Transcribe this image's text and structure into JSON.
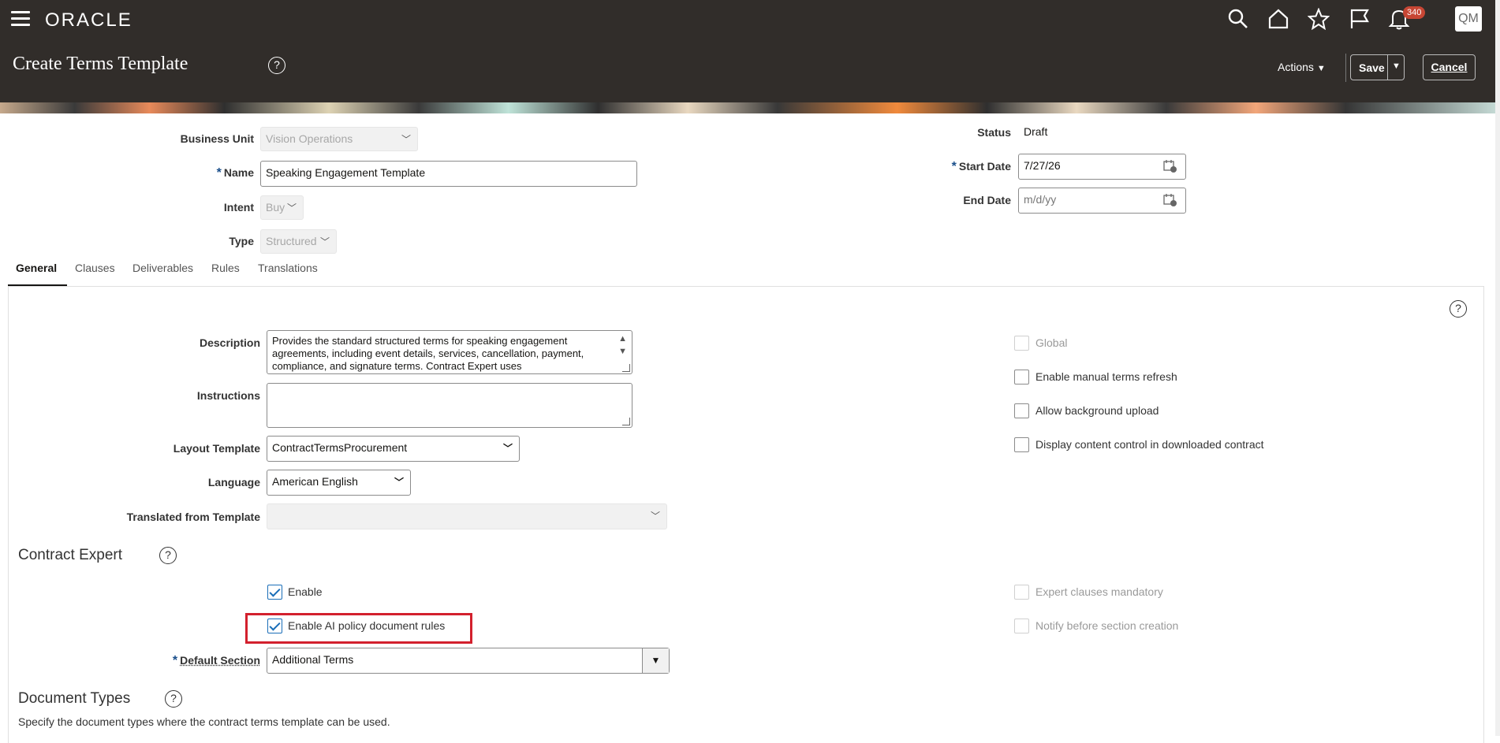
{
  "header": {
    "logo": "ORACLE",
    "notification_count": "340",
    "avatar_initials": "QM",
    "page_title": "Create Terms Template",
    "actions_label": "Actions",
    "save_label": "Save",
    "cancel_label": "Cancel"
  },
  "form": {
    "business_unit": {
      "label": "Business Unit",
      "value": "Vision Operations"
    },
    "name": {
      "label": "Name",
      "value": "Speaking Engagement Template"
    },
    "intent": {
      "label": "Intent",
      "value": "Buy"
    },
    "type": {
      "label": "Type",
      "value": "Structured"
    },
    "status": {
      "label": "Status",
      "value": "Draft"
    },
    "start_date": {
      "label": "Start Date",
      "value": "7/27/26"
    },
    "end_date": {
      "label": "End Date",
      "placeholder": "m/d/yy"
    }
  },
  "tabs": [
    "General",
    "Clauses",
    "Deliverables",
    "Rules",
    "Translations"
  ],
  "general": {
    "description": {
      "label": "Description",
      "value": "Provides the standard structured terms for speaking engagement agreements, including event details, services, cancellation, payment, compliance, and signature terms. Contract Expert uses"
    },
    "instructions": {
      "label": "Instructions",
      "value": ""
    },
    "layout_template": {
      "label": "Layout Template",
      "value": "ContractTermsProcurement"
    },
    "language": {
      "label": "Language",
      "value": "American English"
    },
    "translated_from": {
      "label": "Translated from Template",
      "value": ""
    },
    "checkboxes_right": [
      {
        "label": "Global",
        "checked": false,
        "disabled": true
      },
      {
        "label": "Enable manual terms refresh",
        "checked": false,
        "disabled": false
      },
      {
        "label": "Allow background upload",
        "checked": false,
        "disabled": false
      },
      {
        "label": "Display content control in downloaded contract",
        "checked": false,
        "disabled": false
      }
    ]
  },
  "contract_expert": {
    "title": "Contract Expert",
    "enable": {
      "label": "Enable",
      "checked": true
    },
    "enable_ai": {
      "label": "Enable AI policy document rules",
      "checked": true
    },
    "expert_mandatory": {
      "label": "Expert clauses mandatory",
      "checked": false
    },
    "notify": {
      "label": "Notify before section creation",
      "checked": false
    },
    "default_section": {
      "label": "Default Section",
      "value": "Additional Terms"
    }
  },
  "document_types": {
    "title": "Document Types",
    "description": "Specify the document types where the contract terms template can be used."
  },
  "colors": {
    "header_bg": "#312d2a",
    "accent": "#1a6eb8",
    "highlight": "#d3202d",
    "badge": "#c74634"
  }
}
